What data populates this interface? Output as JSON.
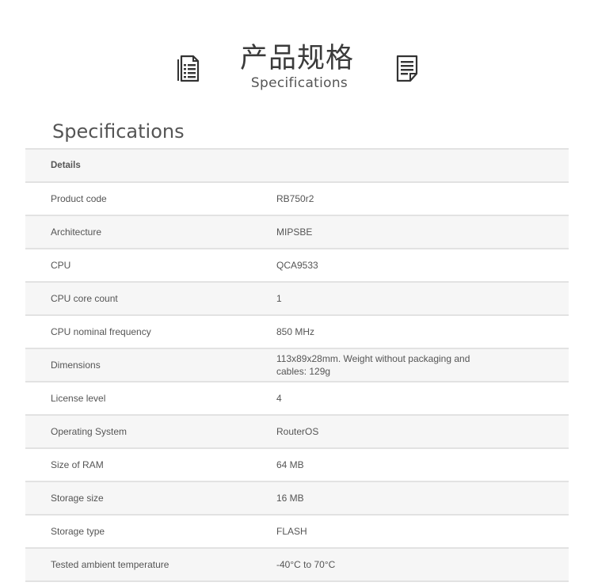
{
  "banner": {
    "title_cn": "产品规格",
    "title_en": "Specifications",
    "left_icon": "document-list-icon",
    "right_icon": "document-lines-icon"
  },
  "section": {
    "title": "Specifications"
  },
  "table": {
    "header": "Details",
    "rows": [
      {
        "label": "Product code",
        "value": "RB750r2"
      },
      {
        "label": "Architecture",
        "value": "MIPSBE"
      },
      {
        "label": "CPU",
        "value": "QCA9533"
      },
      {
        "label": "CPU core count",
        "value": "1"
      },
      {
        "label": "CPU nominal frequency",
        "value": "850 MHz"
      },
      {
        "label": "Dimensions",
        "value": "113x89x28mm. Weight without packaging and cables: 129g"
      },
      {
        "label": "License level",
        "value": "4"
      },
      {
        "label": "Operating System",
        "value": "RouterOS"
      },
      {
        "label": "Size of RAM",
        "value": "64 MB"
      },
      {
        "label": "Storage size",
        "value": "16 MB"
      },
      {
        "label": "Storage type",
        "value": "FLASH"
      },
      {
        "label": "Tested ambient temperature",
        "value": "-40°C to 70°C"
      }
    ]
  },
  "colors": {
    "text": "#555555",
    "heading": "#3b3b3b",
    "row_alt_bg": "#f6f6f6",
    "divider": "#e2e2e2"
  }
}
